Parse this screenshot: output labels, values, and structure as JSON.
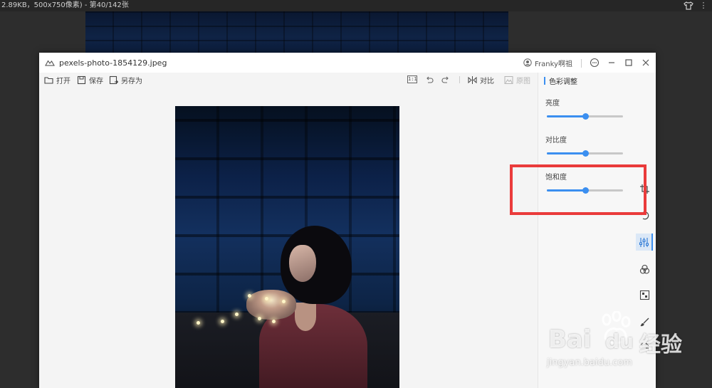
{
  "outer": {
    "title": "2.89KB，500x750像素) - 第40/142张"
  },
  "window": {
    "file_title": "pexels-photo-1854129.jpeg",
    "user_name": "Franky啊祖"
  },
  "toolbar": {
    "open_label": "打开",
    "save_label": "保存",
    "save_as_label": "另存为",
    "ratio_label": "1:1",
    "compare_label": "对比",
    "original_label": "原图"
  },
  "panel": {
    "title": "色彩调整",
    "adjustments": [
      {
        "label": "亮度",
        "value": 0.5
      },
      {
        "label": "对比度",
        "value": 0.5
      },
      {
        "label": "饱和度",
        "value": 0.5
      }
    ]
  },
  "tools": [
    {
      "icon": "crop-icon",
      "active": false
    },
    {
      "icon": "rotate-icon",
      "active": false
    },
    {
      "icon": "adjust-sliders-icon",
      "active": true
    },
    {
      "icon": "color-filter-icon",
      "active": false
    },
    {
      "icon": "mosaic-icon",
      "active": false
    },
    {
      "icon": "brush-icon",
      "active": false
    },
    {
      "icon": "more-tools-icon",
      "active": false
    }
  ],
  "watermark": {
    "brand": "Bai",
    "brand2": "du",
    "cn": "经验",
    "url": "jingyan.baidu.com"
  },
  "colors": {
    "accent": "#3b8ff0",
    "highlight": "#ea3b3b"
  }
}
